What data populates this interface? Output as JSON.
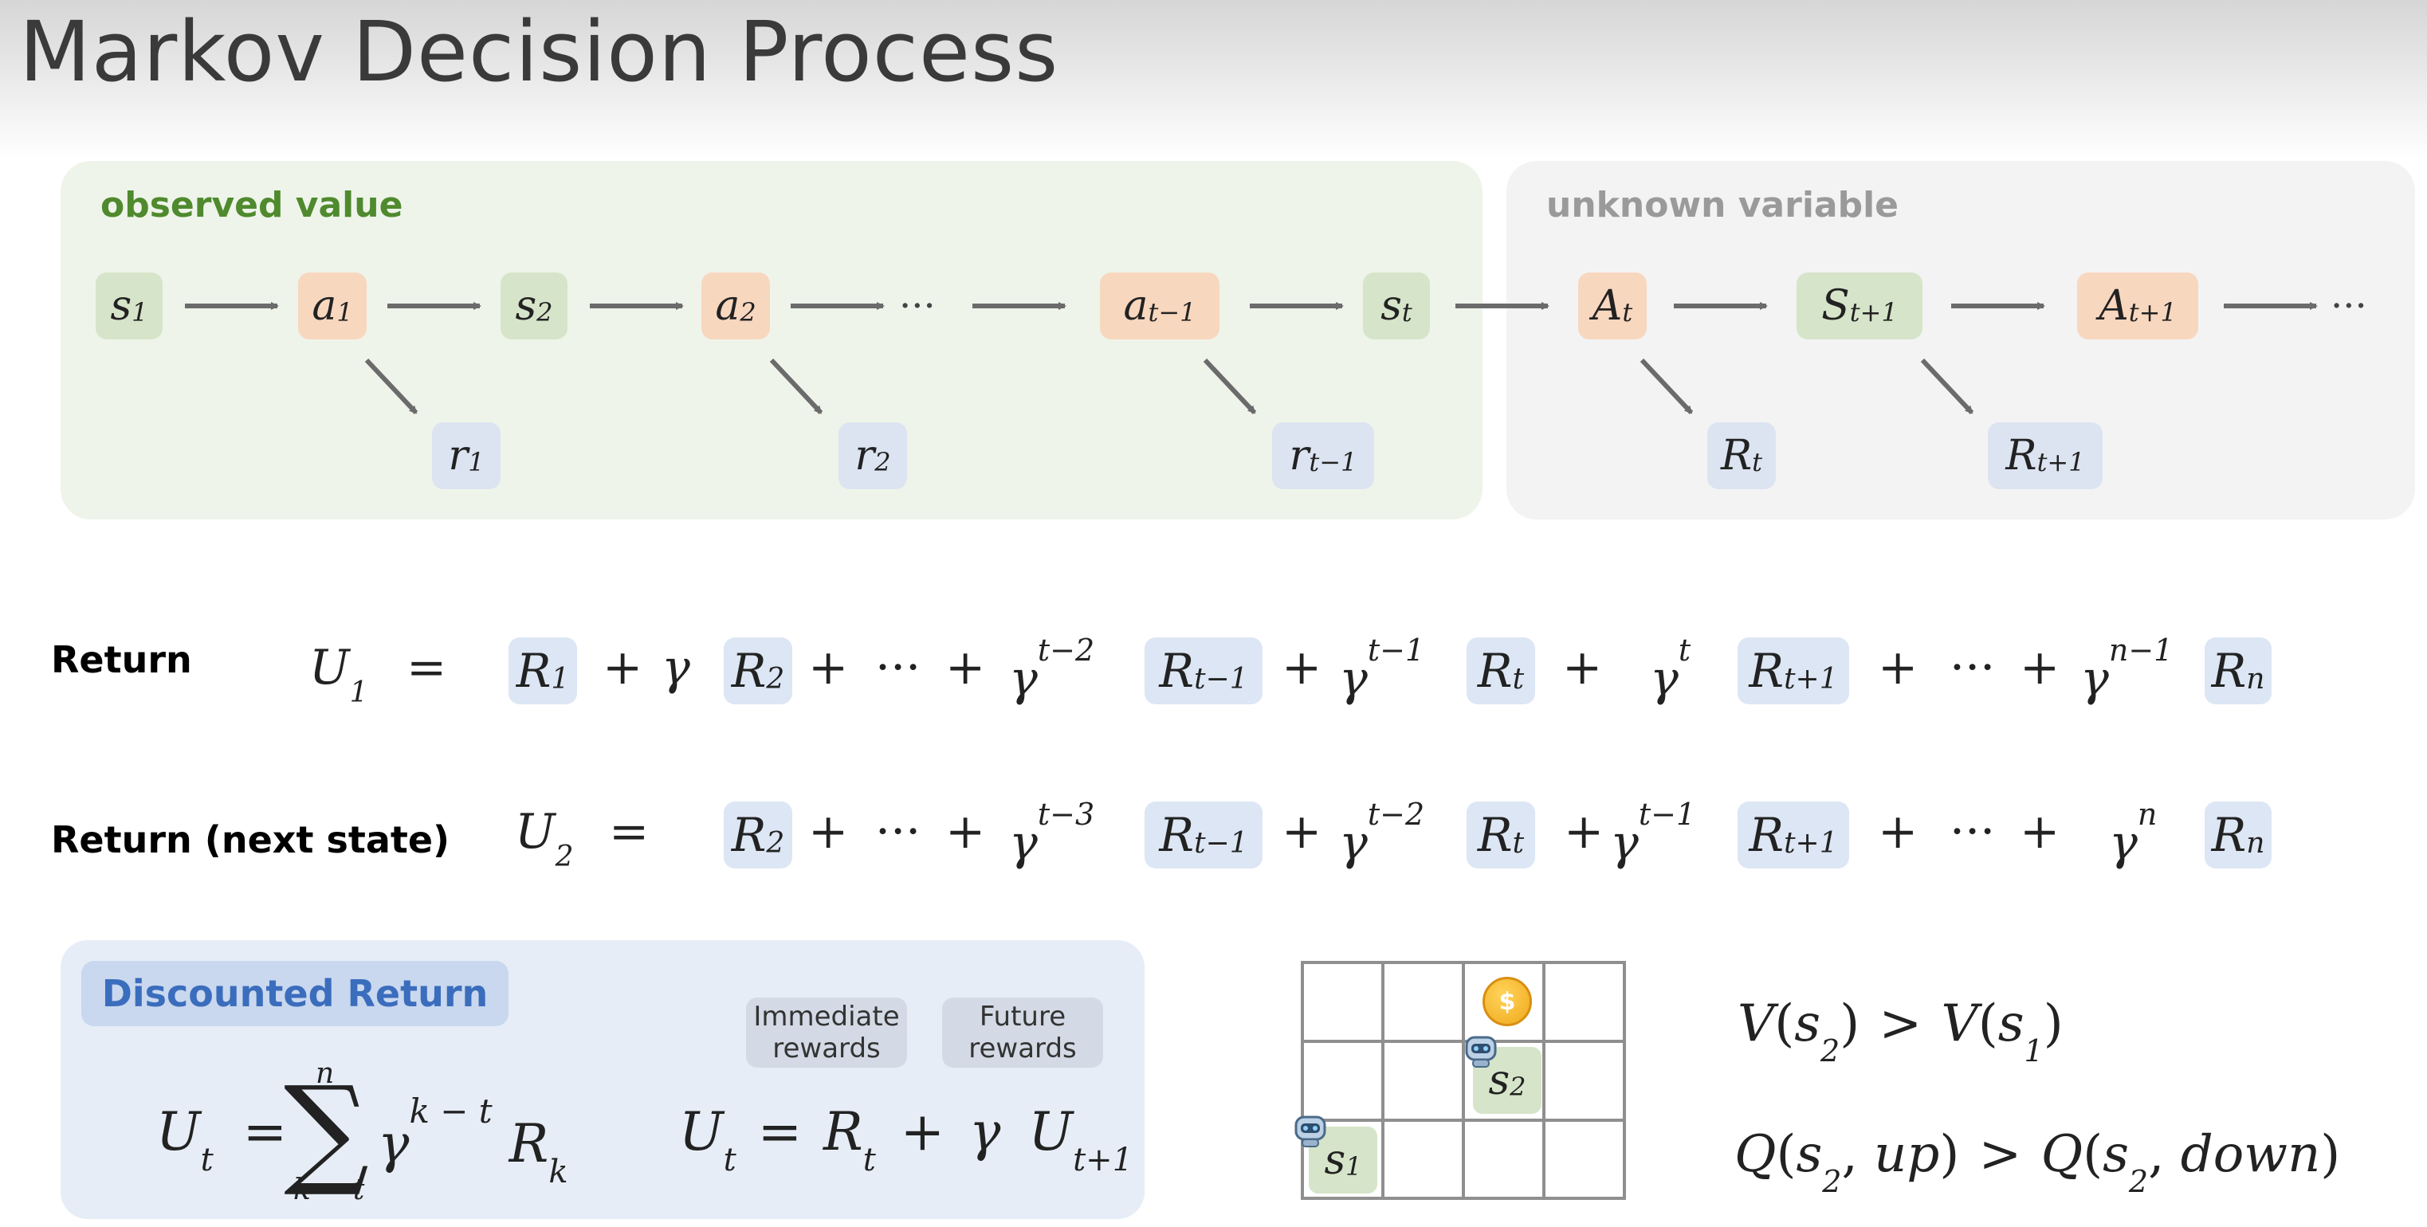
{
  "title": "Markov Decision Process",
  "colors": {
    "observed_panel": "#eff4ea",
    "unknown_panel": "#f3f3f3",
    "observed_label": "#4f8a2e",
    "unknown_label": "#9a9a9a",
    "state_fill": "#d6e4c9",
    "action_fill": "#f8d7bf",
    "reward_fill": "#dce4f1",
    "discount_title": "#3b6dbd"
  },
  "observed": {
    "label": "observed value",
    "states": [
      {
        "sym": "s",
        "sub": "1"
      },
      {
        "sym": "s",
        "sub": "2"
      },
      {
        "sym": "s",
        "sub": "t"
      }
    ],
    "actions": [
      {
        "sym": "a",
        "sub": "1"
      },
      {
        "sym": "a",
        "sub": "2"
      },
      {
        "sym": "a",
        "sub": "t−1"
      }
    ],
    "rewards": [
      {
        "sym": "r",
        "sub": "1"
      },
      {
        "sym": "r",
        "sub": "2"
      },
      {
        "sym": "r",
        "sub": "t−1"
      }
    ],
    "ellipsis": "···"
  },
  "unknown": {
    "label": "unknown variable",
    "nodes": [
      {
        "sym": "A",
        "sub": "t"
      },
      {
        "sym": "S",
        "sub": "t+1"
      },
      {
        "sym": "A",
        "sub": "t+1"
      }
    ],
    "rewards": [
      {
        "sym": "R",
        "sub": "t"
      },
      {
        "sym": "R",
        "sub": "t+1"
      }
    ],
    "ellipsis": "···"
  },
  "return_row": {
    "label": "Return",
    "lhs": {
      "sym": "U",
      "sub": "1"
    },
    "eq": "=",
    "plus": "+",
    "gamma": "γ",
    "dots": "···",
    "exp_t2": "t−2",
    "exp_t1": "t−1",
    "exp_t": "t",
    "exp_n1": "n−1",
    "terms": [
      {
        "sym": "R",
        "sub": "1"
      },
      {
        "sym": "R",
        "sub": "2"
      },
      {
        "sym": "R",
        "sub": "t−1"
      },
      {
        "sym": "R",
        "sub": "t"
      },
      {
        "sym": "R",
        "sub": "t+1"
      },
      {
        "sym": "R",
        "sub": "n"
      }
    ]
  },
  "next_row": {
    "label": "Return (next state)",
    "lhs": {
      "sym": "U",
      "sub": "2"
    },
    "eq": "=",
    "plus": "+",
    "gamma": "γ",
    "dots": "···",
    "exp_t3": "t−3",
    "exp_t2": "t−2",
    "exp_t1": "t−1",
    "exp_n": "n",
    "terms": [
      {
        "sym": "R",
        "sub": "2"
      },
      {
        "sym": "R",
        "sub": "t−1"
      },
      {
        "sym": "R",
        "sub": "t"
      },
      {
        "sym": "R",
        "sub": "t+1"
      },
      {
        "sym": "R",
        "sub": "n"
      }
    ]
  },
  "discounted": {
    "title": "Discounted Return",
    "immediate": [
      "Immediate",
      "rewards"
    ],
    "future": [
      "Future",
      "rewards"
    ],
    "sum": {
      "U": "U",
      "U_sub": "t",
      "eq": "=",
      "sigma": "∑",
      "upper": "n",
      "lower": "k = t",
      "gamma": "γ",
      "exp": "k − t",
      "R": "R",
      "R_sub": "k"
    },
    "recursive": {
      "U": "U",
      "U_sub": "t",
      "eq": "=",
      "R": "R",
      "R_sub": "t",
      "plus": "+",
      "gamma": "γ",
      "U2": "U",
      "U2_sub": "t+1"
    }
  },
  "grid": {
    "rows": 3,
    "cols": 4,
    "coin_symbol": "$",
    "states": [
      {
        "sym": "s",
        "sub": "2"
      },
      {
        "sym": "s",
        "sub": "1"
      }
    ]
  },
  "inequalities": {
    "v": {
      "lhs": "V",
      "s1": "s",
      "s1_sub": "2",
      "op": ">",
      "rhs": "V",
      "s2": "s",
      "s2_sub": "1"
    },
    "q": {
      "lhs": "Q",
      "s": "s",
      "s_sub": "2",
      "a1": "up",
      "op": ">",
      "rhs": "Q",
      "s2": "s",
      "s2_sub": "2",
      "a2": "down"
    }
  }
}
